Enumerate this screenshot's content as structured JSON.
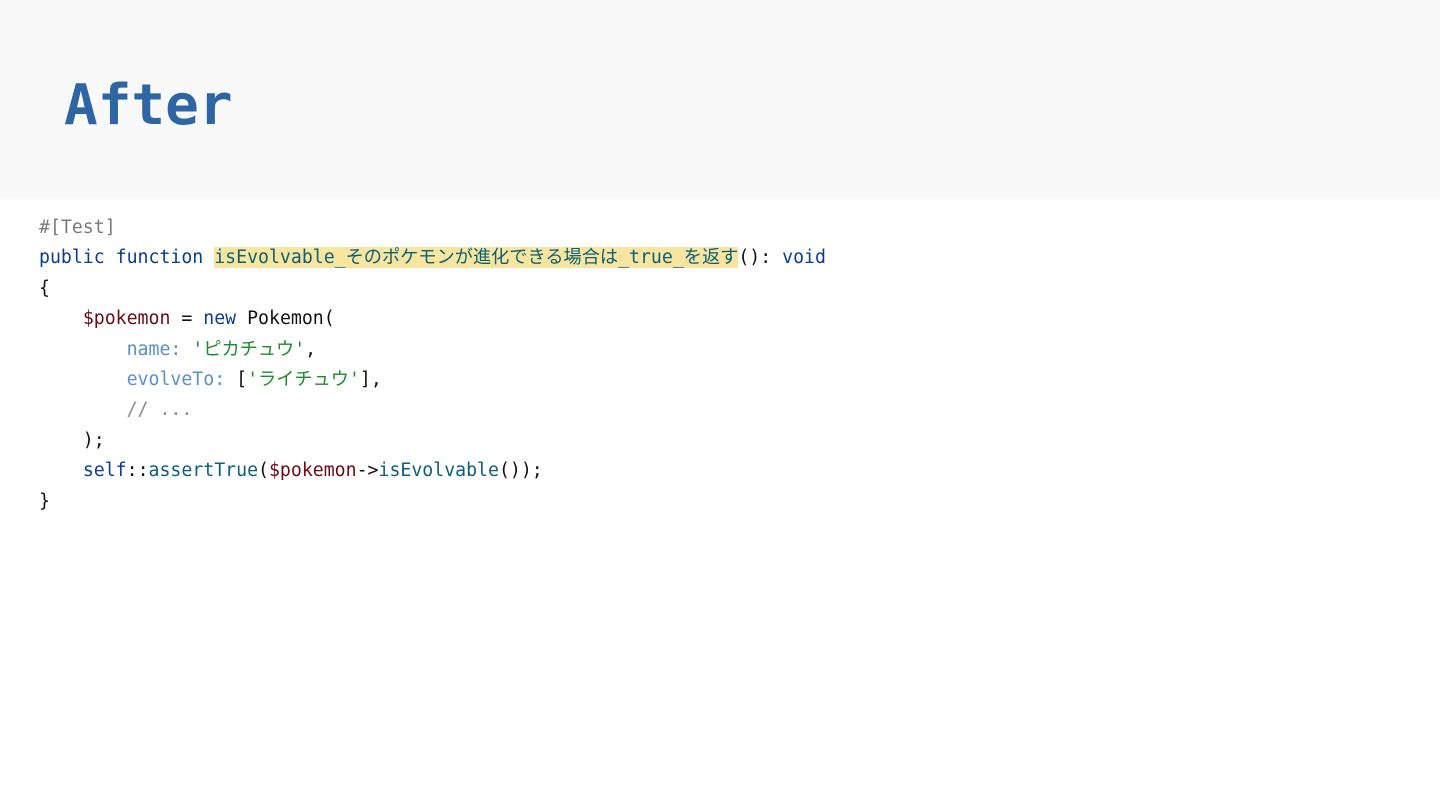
{
  "slide": {
    "title": "After"
  },
  "code": {
    "lines": [
      [
        {
          "text": "#[Test]",
          "kind": "attr"
        }
      ],
      [
        {
          "text": "public",
          "kind": "kw"
        },
        {
          "text": " ",
          "kind": "plain"
        },
        {
          "text": "function",
          "kind": "kw"
        },
        {
          "text": " ",
          "kind": "plain"
        },
        {
          "text": "isEvolvable_そのポケモンが進化できる場合は_true_を返す",
          "kind": "fn-highlight"
        },
        {
          "text": "(): ",
          "kind": "plain"
        },
        {
          "text": "void",
          "kind": "kw"
        }
      ],
      [
        {
          "text": "{",
          "kind": "plain"
        }
      ],
      [
        {
          "text": "    ",
          "kind": "plain"
        },
        {
          "text": "$pokemon",
          "kind": "var"
        },
        {
          "text": " = ",
          "kind": "plain"
        },
        {
          "text": "new",
          "kind": "kw"
        },
        {
          "text": " Pokemon(",
          "kind": "plain"
        }
      ],
      [
        {
          "text": "        ",
          "kind": "plain"
        },
        {
          "text": "name:",
          "kind": "param"
        },
        {
          "text": " ",
          "kind": "plain"
        },
        {
          "text": "'ピカチュウ'",
          "kind": "str"
        },
        {
          "text": ",",
          "kind": "plain"
        }
      ],
      [
        {
          "text": "        ",
          "kind": "plain"
        },
        {
          "text": "evolveTo:",
          "kind": "param"
        },
        {
          "text": " [",
          "kind": "plain"
        },
        {
          "text": "'ライチュウ'",
          "kind": "str"
        },
        {
          "text": "],",
          "kind": "plain"
        }
      ],
      [
        {
          "text": "        ",
          "kind": "plain"
        },
        {
          "text": "// ...",
          "kind": "comment"
        }
      ],
      [
        {
          "text": "    );",
          "kind": "plain"
        }
      ],
      [
        {
          "text": "    ",
          "kind": "plain"
        },
        {
          "text": "self",
          "kind": "kw"
        },
        {
          "text": "::",
          "kind": "plain"
        },
        {
          "text": "assertTrue",
          "kind": "fn"
        },
        {
          "text": "(",
          "kind": "plain"
        },
        {
          "text": "$pokemon",
          "kind": "var"
        },
        {
          "text": "->",
          "kind": "plain"
        },
        {
          "text": "isEvolvable",
          "kind": "fn"
        },
        {
          "text": "());",
          "kind": "plain"
        }
      ],
      [
        {
          "text": "}",
          "kind": "plain"
        }
      ]
    ]
  },
  "colors": {
    "title": "#2e65a3",
    "header_bg": "#f9f9f9",
    "highlight": "#f8e6a0",
    "keyword": "#0a3d91",
    "function": "#0b5f78",
    "variable": "#6b0b16",
    "string": "#1f8a2e",
    "param": "#5e8fc8",
    "comment": "#8a8a8a"
  }
}
